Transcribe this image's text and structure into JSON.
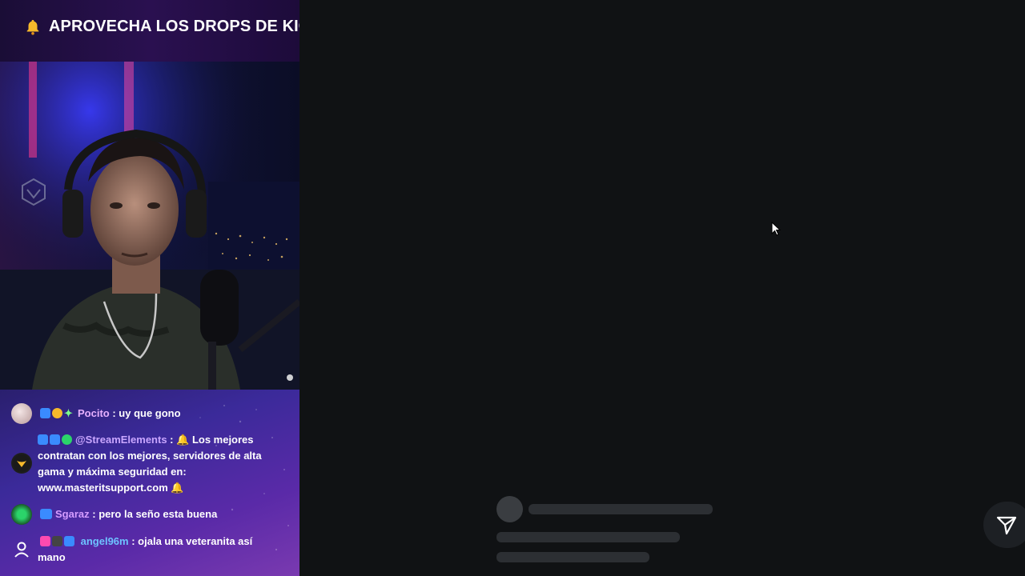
{
  "banner": {
    "icon": "bell-icon",
    "text": "APROVECHA LOS DROPS DE KIC"
  },
  "chat": {
    "messages": [
      {
        "user": "Pocito",
        "separator": " : ",
        "text": "uy que gono",
        "user_color": "#e6b0ff",
        "badges": [
          "sub-badge",
          "gift-badge",
          "sparkle-badge"
        ]
      },
      {
        "user": "@StreamElements",
        "separator": " : ",
        "text_lines": [
          "Los mejores",
          "contratan con los mejores, servidores de alta",
          "gama y máxima seguridad en:",
          "www.masteritsupport.com"
        ],
        "user_color": "#c9a6ff",
        "badges": [
          "bot-badge",
          "sub-badge",
          "verified-badge"
        ]
      },
      {
        "user": "Sgaraz",
        "separator": " : ",
        "text": "pero la seño esta buena",
        "user_color": "#d59cff",
        "badges": [
          "og-badge"
        ]
      },
      {
        "user": "angel96m",
        "separator": " : ",
        "text_lines": [
          "ojala una veteranita así",
          "mano"
        ],
        "user_color": "#6ec3ff",
        "badges": [
          "heart-badge",
          "founder-badge",
          "crown-badge"
        ]
      }
    ]
  },
  "colors": {
    "background": "#101214",
    "skeleton": "#2c2f33",
    "accent_green": "#53fc18"
  }
}
